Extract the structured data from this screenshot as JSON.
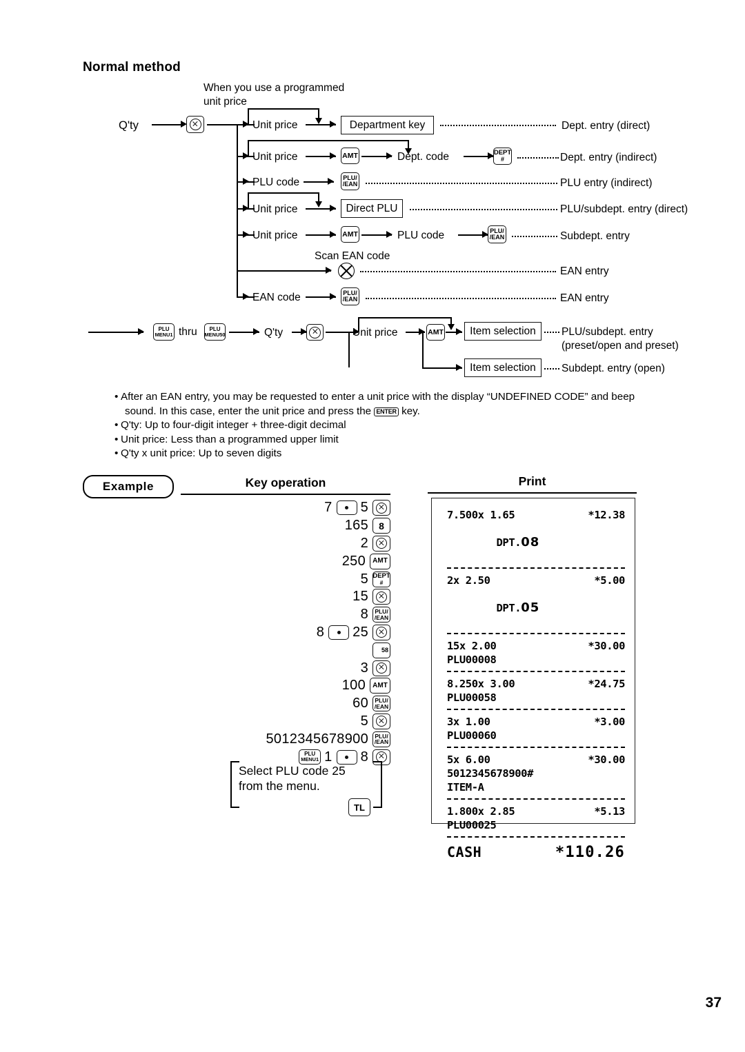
{
  "heading": "Normal method",
  "diagram": {
    "note_programmed_price": "When you use a programmed\nunit price",
    "note_scan_ean": "Scan EAN code",
    "start_label": "Q'ty",
    "keys": {
      "multiply": "⊗",
      "amt": "AMT",
      "dept_hash_1": "DEPT",
      "dept_hash_2": "#",
      "plu_ean_1": "PLU/",
      "plu_ean_2": "/EAN",
      "plu_menu1_1": "PLU",
      "plu_menu1_2": "MENU1",
      "plu_menu50_1": "PLU",
      "plu_menu50_2": "MENU50"
    },
    "rows": [
      {
        "step": "Unit price",
        "box": "Department key",
        "result": "Dept. entry (direct)"
      },
      {
        "step": "Unit price",
        "step2": "Dept. code",
        "result": "Dept. entry (indirect)"
      },
      {
        "step": "PLU code",
        "result": "PLU entry (indirect)"
      },
      {
        "step": "Unit price",
        "box": "Direct PLU",
        "result": "PLU/subdept. entry (direct)"
      },
      {
        "step": "Unit price",
        "step2": "PLU code",
        "result": "Subdept. entry"
      },
      {
        "step": "",
        "result": "EAN entry"
      },
      {
        "step": "EAN code",
        "result": "EAN entry"
      }
    ],
    "menu_row": {
      "thru": "thru",
      "qty": "Q'ty",
      "unit_price": "Unit price",
      "item_selection": "Item selection",
      "result_1a": "PLU/subdept. entry",
      "result_1b": "(preset/open and preset)",
      "result_2": "Subdept. entry (open)"
    }
  },
  "notes": [
    "After an EAN entry, you may be requested to enter a unit price with the display “UNDEFINED CODE” and beep",
    "sound.  In this case, enter the unit price and press the",
    "key.",
    "Q'ty: Up to four-digit integer + three-digit decimal",
    "Unit price: Less than a programmed upper limit",
    "Q'ty x unit price: Up to seven digits"
  ],
  "notes_enter_key": "ENTER",
  "example": {
    "badge": "Example",
    "keyop_title": "Key operation",
    "print_title": "Print",
    "key_operation": [
      {
        "num": "7",
        "dot": true,
        "num2": "5",
        "key": "multiply"
      },
      {
        "num": "165",
        "key": "8"
      },
      {
        "num": "2",
        "key": "multiply"
      },
      {
        "num": "250",
        "key": "AMT"
      },
      {
        "num": "5",
        "key": "DEPT#"
      },
      {
        "num": "15",
        "key": "multiply"
      },
      {
        "num": "8",
        "key": "PLU/EAN"
      },
      {
        "num": "8",
        "dot": true,
        "num2": "25",
        "key": "multiply"
      },
      {
        "num": "",
        "key": "58"
      },
      {
        "num": "3",
        "key": "multiply"
      },
      {
        "num": "100",
        "key": "AMT"
      },
      {
        "num": "60",
        "key": "PLU/EAN"
      },
      {
        "num": "5",
        "key": "multiply"
      },
      {
        "num": "5012345678900",
        "key": "PLU/EAN"
      },
      {
        "prekey": "PLUMENU1",
        "num": "1",
        "dot": true,
        "num2": "8",
        "key": "multiply"
      }
    ],
    "bracket_note": "Select PLU code 25\nfrom the menu.",
    "final_key": "TL"
  },
  "receipt": {
    "items": [
      {
        "qty_price": "7.500x 1.65",
        "amount": "*12.38",
        "label_prefix": "DPT.",
        "label_num": "08"
      },
      {
        "qty_price": "2x 2.50",
        "amount": "*5.00",
        "label_prefix": "DPT.",
        "label_num": "05"
      },
      {
        "qty_price": "15x 2.00",
        "amount": "*30.00",
        "label_prefix": "PLU00008"
      },
      {
        "qty_price": "8.250x 3.00",
        "amount": "*24.75",
        "label_prefix": "PLU00058"
      },
      {
        "qty_price": "3x 1.00",
        "amount": "*3.00",
        "label_prefix": "PLU00060"
      },
      {
        "qty_price": "5x 6.00",
        "amount": "*30.00",
        "label_prefix": "5012345678900#",
        "label_extra": "ITEM-A"
      },
      {
        "qty_price": "1.800x 2.85",
        "amount": "*5.13",
        "label_prefix": "PLU00025"
      }
    ],
    "total_label": "CASH",
    "total_amount": "*110.26"
  },
  "page_number": "37"
}
